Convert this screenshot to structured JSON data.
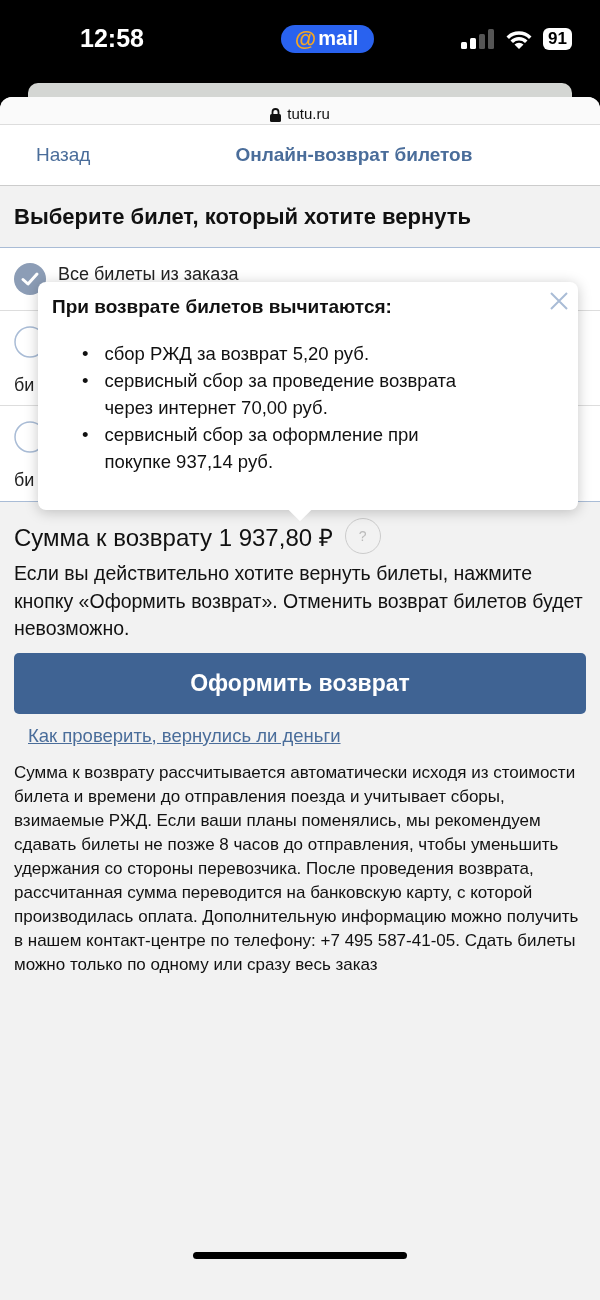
{
  "status_bar": {
    "time": "12:58",
    "pill_symbol": "@",
    "pill_text": "mail",
    "battery": "91"
  },
  "browser": {
    "url": "tutu.ru"
  },
  "nav": {
    "back": "Назад",
    "title": "Онлайн-возврат билетов"
  },
  "heading": "Выберите билет, который хотите вернуть",
  "options": [
    {
      "label": "Все билеты из заказа",
      "selected": true
    },
    {
      "label": "би",
      "selected": false
    },
    {
      "label": "би",
      "selected": false
    }
  ],
  "popover": {
    "title": "При возврате билетов вычитаются:",
    "bullet": "•",
    "items": [
      "сбор РЖД за возврат 5,20 руб.",
      "сервисный сбор за проведение возврата через интернет 70,00 руб.",
      "сервисный сбор за оформление при покупке 937,14 руб."
    ]
  },
  "sum": {
    "label": "Сумма к возврату 1 937,80 ₽",
    "help": "?"
  },
  "warning": "Если вы действительно хотите вернуть билеты, нажмите кнопку «Оформить возврат». Отменить возврат билетов будет невозможно.",
  "submit": "Оформить возврат",
  "link": "Как проверить, вернулись ли деньги",
  "info": "Сумма к возврату рассчитывается автоматически исходя из стоимости билета и времени до отправления поезда и учитывает сборы, взимаемые РЖД. Если ваши планы поменялись, мы рекомендуем сдавать билеты не позже 8 часов до отправления, чтобы уменьшить удержания со стороны перевозчика. После проведения возврата, рассчитанная сумма переводится на банковскую карту, с которой производилась оплата. Дополнительную информацию можно получить в нашем контакт-центре по телефону: +7 495 587-41-05. Сдать билеты можно только по одному или сразу весь заказ"
}
